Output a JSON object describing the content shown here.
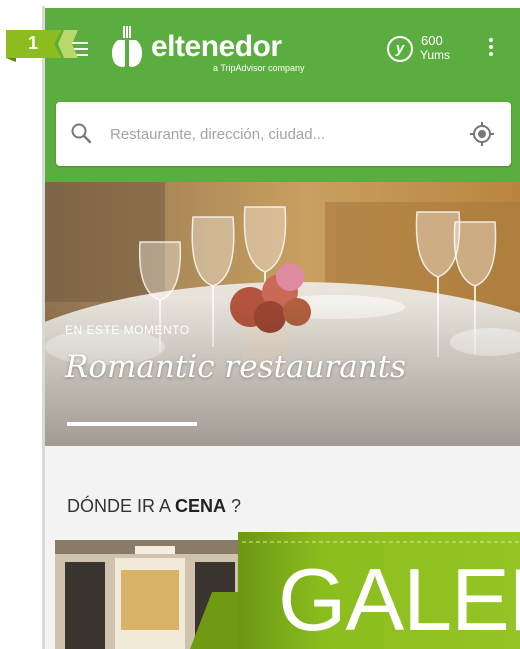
{
  "step_badge": {
    "number": "1"
  },
  "header": {
    "logo_text": "eltenedor",
    "logo_subtitle": "a TripAdvisor company",
    "yums_symbol": "y",
    "yums_count": "600",
    "yums_label": "Yums",
    "background_color": "#5cad3f"
  },
  "search": {
    "placeholder": "Restaurante, dirección, ciudad...",
    "search_icon": "search-icon",
    "locate_icon": "crosshair-icon"
  },
  "hero": {
    "kicker": "EN ESTE MOMENTO",
    "title": "Romantic restaurants"
  },
  "section": {
    "prefix": "DÓNDE IR A ",
    "emphasis": "CENA",
    "suffix": " ?"
  },
  "banner": {
    "text": "GALER",
    "color": "#8bbd1e"
  }
}
